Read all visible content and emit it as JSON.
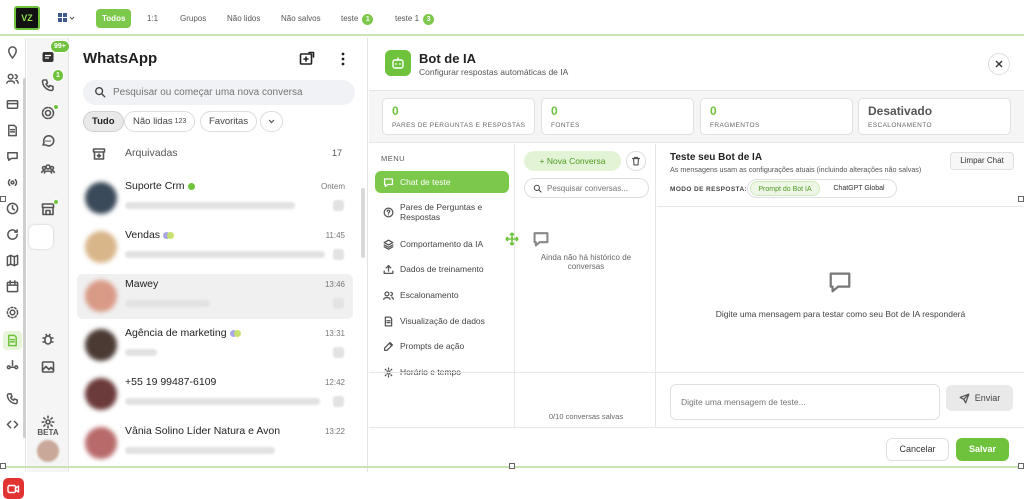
{
  "topbar": {
    "logo_text": "VZ",
    "filters": [
      {
        "label": "Todos",
        "active": true
      },
      {
        "label": "1:1"
      },
      {
        "label": "Grupos"
      },
      {
        "label": "Não lidos"
      },
      {
        "label": "Não salvos"
      },
      {
        "label": "teste",
        "count": "1"
      },
      {
        "label": "teste 1",
        "count": "3"
      }
    ]
  },
  "rail2": {
    "inbox_badge": "99+",
    "calls_badge": "1",
    "beta_label": "BETA"
  },
  "chatlist": {
    "title": "WhatsApp",
    "search_placeholder": "Pesquisar ou começar uma nova conversa",
    "chips": [
      {
        "label": "Tudo",
        "active": true
      },
      {
        "label": "Não lidas",
        "count": "123"
      },
      {
        "label": "Favoritas"
      }
    ],
    "archived_label": "Arquivadas",
    "archived_count": "17",
    "chats": [
      {
        "name": "Suporte Crm",
        "time": "Ontem",
        "avatar_color": "#3b4a5a"
      },
      {
        "name": "Vendas",
        "time": "11:45",
        "avatar_color": "#d9b58a"
      },
      {
        "name": "Mawey",
        "time": "13:46",
        "avatar_color": "#d99a86"
      },
      {
        "name": "Agência de marketing",
        "time": "13:31",
        "avatar_color": "#4a3a33"
      },
      {
        "name": "+55 19 99487-6109",
        "time": "12:42",
        "avatar_color": "#6b3a3a"
      },
      {
        "name": "Vânia Solino Líder Natura e Avon",
        "time": "13:22",
        "avatar_color": "#b86a6a"
      }
    ]
  },
  "panel": {
    "title": "Bot de IA",
    "subtitle": "Configurar respostas automáticas de IA",
    "stats": [
      {
        "value": "0",
        "label": "PARES DE PERGUNTAS E RESPOSTAS"
      },
      {
        "value": "0",
        "label": "FONTES"
      },
      {
        "value": "0",
        "label": "FRAGMENTOS"
      },
      {
        "value": "Desativado",
        "label": "ESCALONAMENTO"
      }
    ],
    "menu_title": "MENU",
    "menu": [
      {
        "label": "Chat de teste",
        "icon": "chat-icon",
        "active": true
      },
      {
        "label": "Pares de Perguntas e Respostas",
        "icon": "help-circle-icon"
      },
      {
        "label": "Comportamento da IA",
        "icon": "layers-icon"
      },
      {
        "label": "Dados de treinamento",
        "icon": "upload-icon"
      },
      {
        "label": "Escalonamento",
        "icon": "users-icon"
      },
      {
        "label": "Visualização de dados",
        "icon": "document-icon"
      },
      {
        "label": "Prompts de ação",
        "icon": "edit-icon"
      },
      {
        "label": "Horário e tempo",
        "icon": "gear-icon"
      }
    ],
    "new_conversation_label": "Nova Conversa",
    "conv_search_placeholder": "Pesquisar conversas...",
    "conv_empty_text": "Ainda não há histórico de conversas",
    "conv_count": "0/10 conversas salvas",
    "test_title": "Teste seu Bot de IA",
    "test_subtitle": "As mensagens usam as configurações atuais (incluindo alterações não salvas)",
    "clear_label": "Limpar Chat",
    "mode_label": "MODO DE RESPOSTA:",
    "modes": [
      {
        "label": "Prompt do Bot IA",
        "active": true
      },
      {
        "label": "ChatGPT Global"
      }
    ],
    "test_empty_text": "Digite uma mensagem para testar como seu Bot de IA responderá",
    "test_input_placeholder": "Digite uma mensagem de teste...",
    "send_label": "Enviar",
    "cancel_label": "Cancelar",
    "save_label": "Salvar"
  },
  "colors": {
    "accent": "#6fc23b",
    "accent_light": "#e3f3d6",
    "danger": "#e23333"
  }
}
